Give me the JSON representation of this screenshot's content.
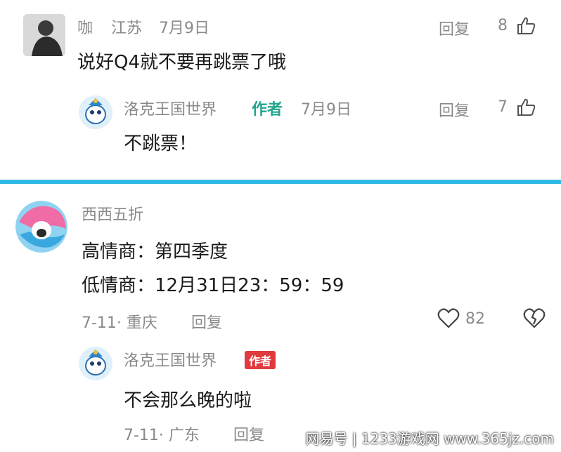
{
  "comment1": {
    "user": "咖",
    "location": "江苏",
    "date": "7月9日",
    "text": "说好Q4就不要再跳票了哦",
    "reply_label": "回复",
    "likes": "8",
    "reply": {
      "user": "洛克王国世界",
      "author_tag": "作者",
      "date": "7月9日",
      "text": "不跳票！",
      "reply_label": "回复",
      "likes": "7"
    }
  },
  "comment2": {
    "user": "西西五折",
    "line1": "高情商：第四季度",
    "line2": "低情商：12月31日23：59：59",
    "meta": "7-11· 重庆",
    "reply_label": "回复",
    "likes": "82",
    "reply": {
      "user": "洛克王国世界",
      "author_tag": "作者",
      "text": "不会那么晚的啦",
      "meta": "7-11· 广东",
      "reply_label": "回复"
    }
  },
  "watermark": "网易号 | 1233游戏网 www.365jz.com",
  "colors": {
    "accent_bar": "#31b9e6",
    "author_teal": "#21a58f",
    "author_red": "#e0393e"
  }
}
